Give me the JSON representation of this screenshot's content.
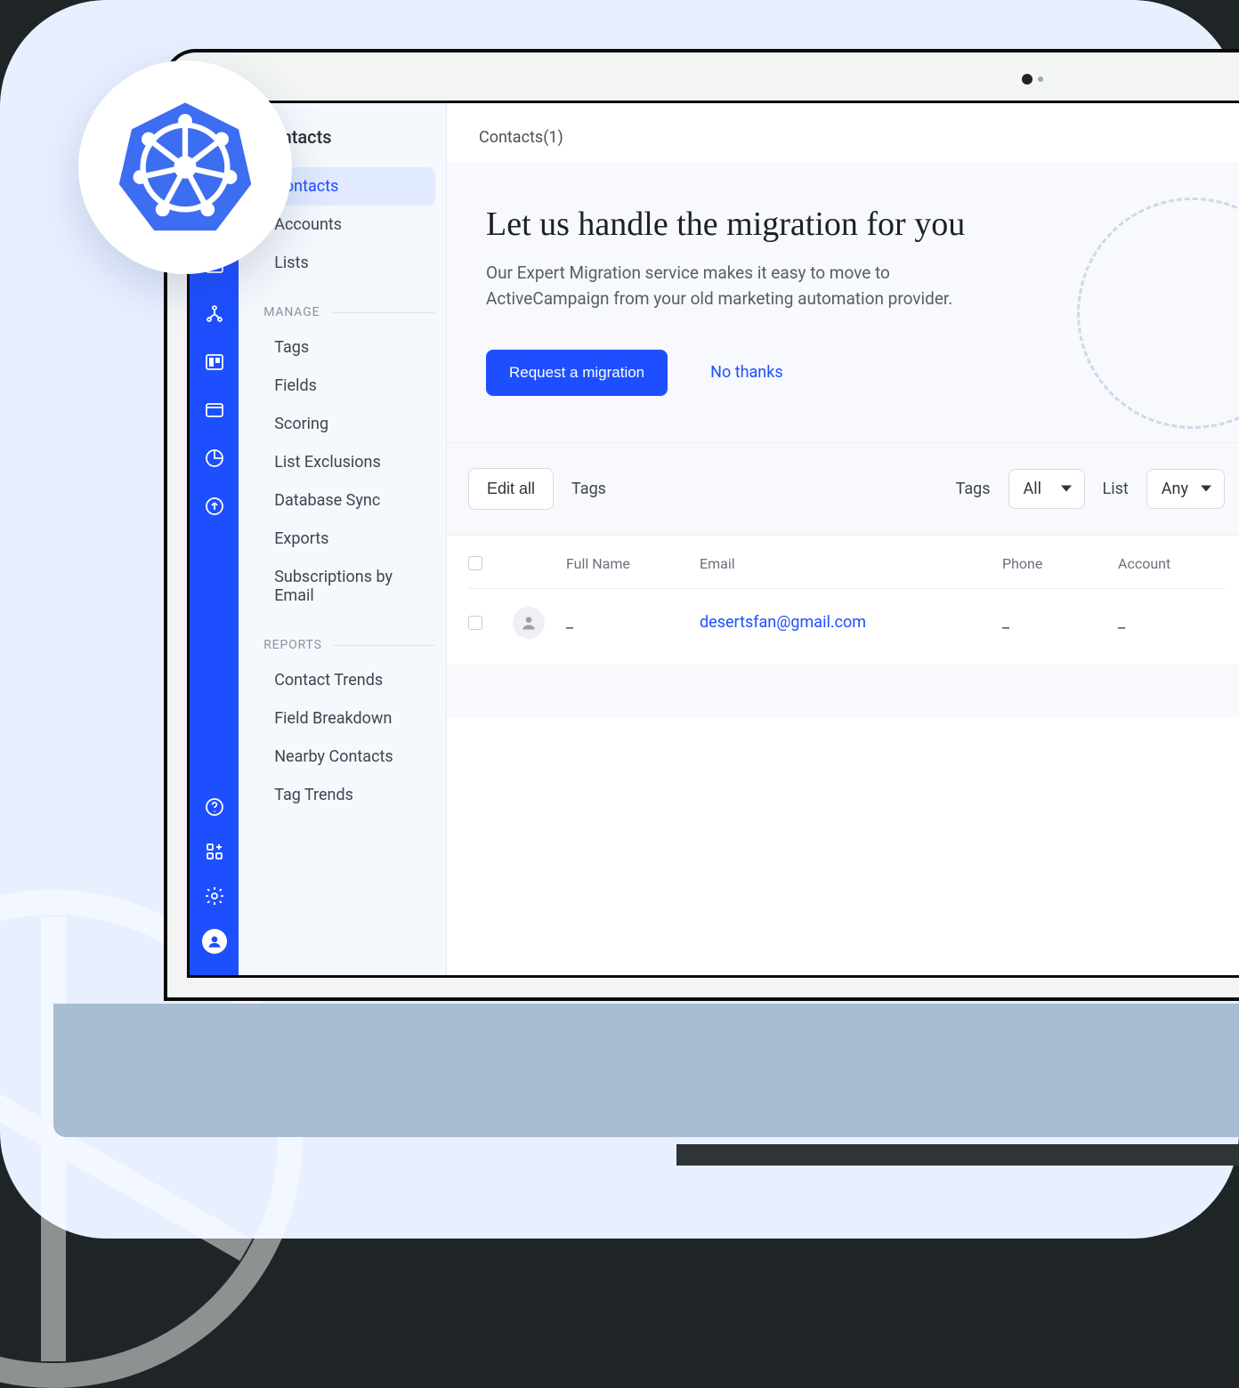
{
  "sidebar": {
    "title": "Contacts",
    "main_items": [
      {
        "label": "Contacts",
        "active": true
      },
      {
        "label": "Accounts",
        "active": false
      },
      {
        "label": "Lists",
        "active": false
      }
    ],
    "groups": [
      {
        "label": "MANAGE",
        "items": [
          "Tags",
          "Fields",
          "Scoring",
          "List Exclusions",
          "Database Sync",
          "Exports",
          "Subscriptions by Email"
        ]
      },
      {
        "label": "REPORTS",
        "items": [
          "Contact Trends",
          "Field Breakdown",
          "Nearby Contacts",
          "Tag Trends"
        ]
      }
    ]
  },
  "rail_icons": [
    "mail",
    "share",
    "board",
    "window",
    "clock",
    "upload"
  ],
  "rail_bottom_icons": [
    "help",
    "apps",
    "settings",
    "avatar"
  ],
  "breadcrumb": "Contacts(1)",
  "hero": {
    "title": "Let us handle the migration for you",
    "body": "Our Expert Migration service makes it easy to move to ActiveCampaign from your old marketing automation provider.",
    "primary": "Request a migration",
    "secondary": "No thanks"
  },
  "toolbar": {
    "edit_all": "Edit all",
    "tags_label": "Tags",
    "filter_tags_label": "Tags",
    "filter_tags_value": "All",
    "filter_list_label": "List",
    "filter_list_value": "Any"
  },
  "table": {
    "columns": [
      "",
      "",
      "Full Name",
      "Email",
      "Phone",
      "Account"
    ],
    "rows": [
      {
        "full_name": "_",
        "email": "desertsfan@gmail.com",
        "phone": "_",
        "account": "_"
      }
    ]
  },
  "colors": {
    "accent": "#1e4fff"
  }
}
